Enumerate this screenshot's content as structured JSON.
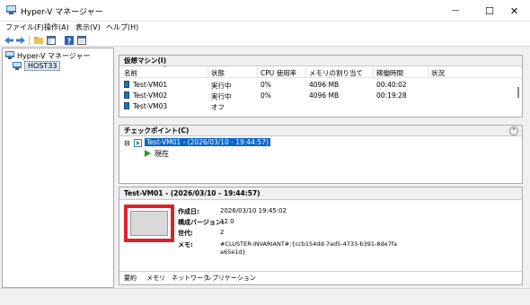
{
  "window": {
    "title": "Hyper-V マネージャー",
    "minimize_glyph": "—",
    "maximize_glyph": "☐",
    "close_glyph": "✕"
  },
  "menu": {
    "items": [
      "ファイル(F)",
      "操作(A)",
      "表示(V)",
      "ヘルプ(H)"
    ]
  },
  "toolbar": {
    "icons": [
      "back-icon",
      "forward-icon",
      "folder-icon",
      "panel-icon",
      "help-icon",
      "console-icon"
    ]
  },
  "tree": {
    "root": "Hyper-V マネージャー",
    "host": "HOST33"
  },
  "vms": {
    "header": "仮想マシン(I)",
    "columns": [
      "名前",
      "状態",
      "CPU 使用率",
      "メモリの割り当て",
      "稼働時間",
      "状況"
    ],
    "rows": [
      {
        "name": "Test-VM01",
        "state": "実行中",
        "cpu": "0%",
        "memory": "4096 MB",
        "uptime": "00:40:02"
      },
      {
        "name": "Test-VM02",
        "state": "実行中",
        "cpu": "0%",
        "memory": "4096 MB",
        "uptime": "00:19:28"
      },
      {
        "name": "Test-VM03",
        "state": "オフ",
        "cpu": "",
        "memory": "",
        "uptime": ""
      }
    ]
  },
  "checkpoints": {
    "header": "チェックポイント(C)",
    "collapse_glyph": "⌃",
    "expand_glyph": "⊟",
    "node": "Test-VM01 - (2026/03/10 - 19:44:57)",
    "current": "現在"
  },
  "details": {
    "title": "Test-VM01 - (2026/03/10 - 19:44:57)",
    "fields": [
      {
        "label": "作成日:",
        "value": "2026/03/10 19:45:02"
      },
      {
        "label": "構成バージョン:",
        "value": "12.0"
      },
      {
        "label": "世代:",
        "value": "2"
      },
      {
        "label": "メモ:",
        "value": "#CLUSTER-INVARIANT#:{ccb154dd-7ad5-4733-b391-8de7fa\na65e1d}"
      }
    ],
    "tabs": [
      "要約",
      "メモリ",
      "ネットワーク",
      "レプリケーション"
    ]
  },
  "colors": {
    "highlight_box": "#d9242a",
    "selection": "#0a64c8",
    "thumbnail": "#d9d9d9"
  }
}
